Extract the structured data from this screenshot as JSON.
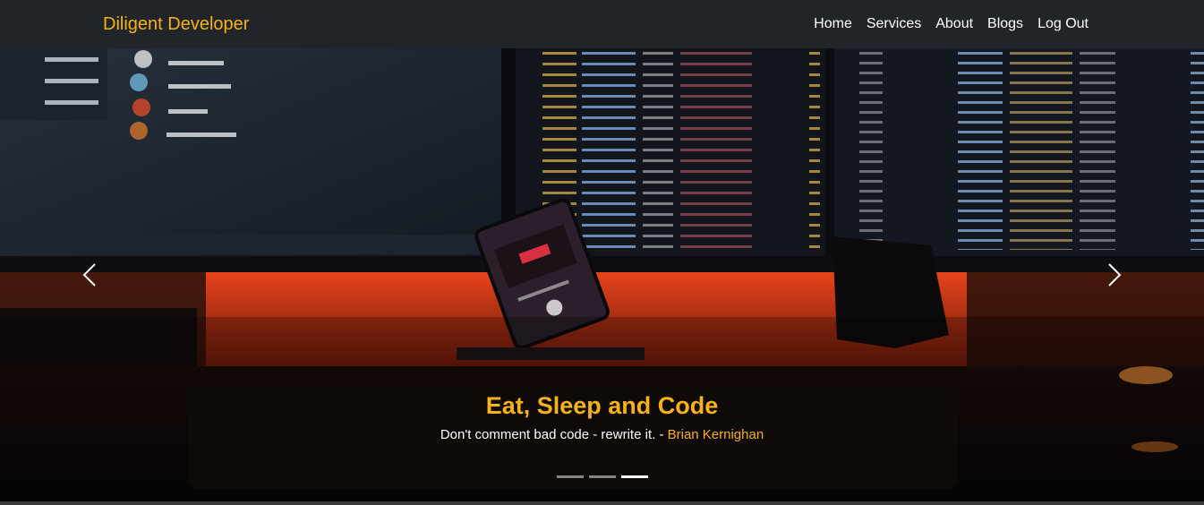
{
  "navbar": {
    "brand": "Diligent Developer",
    "links": [
      "Home",
      "Services",
      "About",
      "Blogs",
      "Log Out"
    ]
  },
  "carousel": {
    "slide_count": 3,
    "active_slide": 3,
    "caption": {
      "title": "Eat, Sleep and Code",
      "quote": "Don't comment bad code - rewrite it. - ",
      "author": "Brian Kernighan"
    },
    "prev_icon": "chevron-left-icon",
    "next_icon": "chevron-right-icon"
  },
  "colors": {
    "accent": "#f5b21a",
    "navbar_bg": "#212529",
    "glow": "#ff4a1c"
  }
}
